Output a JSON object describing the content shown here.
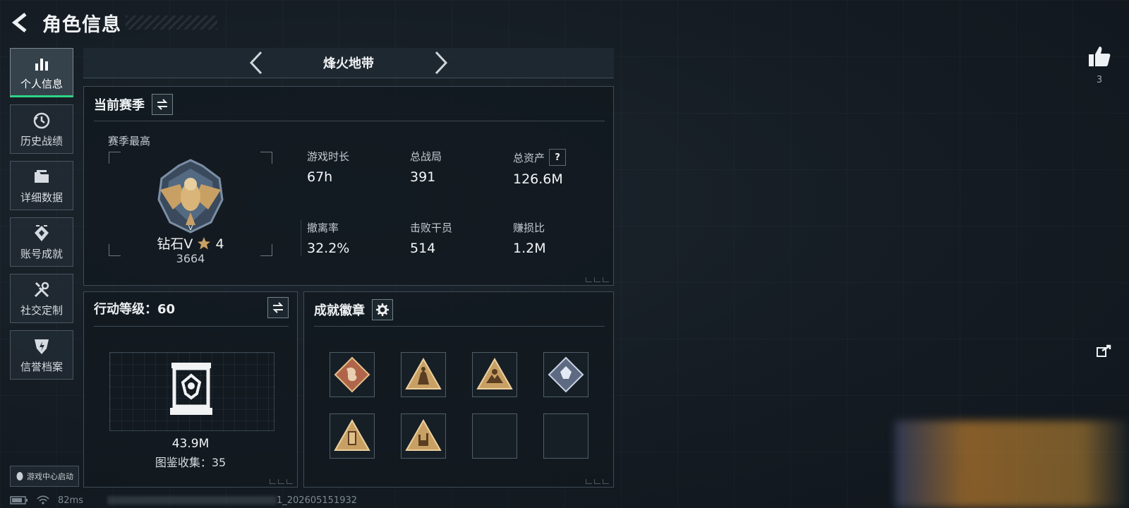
{
  "header": {
    "title": "角色信息"
  },
  "sidebar": {
    "items": [
      {
        "label": "个人信息",
        "icon": "bar-chart-icon",
        "active": true
      },
      {
        "label": "历史战绩",
        "icon": "clock-history-icon"
      },
      {
        "label": "详细数据",
        "icon": "folder-icon"
      },
      {
        "label": "账号成就",
        "icon": "achievement-icon"
      },
      {
        "label": "社交定制",
        "icon": "tools-icon"
      },
      {
        "label": "信誉档案",
        "icon": "shield-icon"
      }
    ],
    "game_center_label": "游戏中心启动"
  },
  "mode_selector": {
    "name": "烽火地带"
  },
  "season": {
    "title": "当前赛季",
    "best_label": "赛季最高",
    "rank_name": "钻石V",
    "rank_stars": "4",
    "rank_score": "3664",
    "stats": [
      {
        "label": "游戏时长",
        "value": "67h"
      },
      {
        "label": "总战局",
        "value": "391"
      },
      {
        "label": "总资产",
        "value": "126.6M",
        "help": "?"
      },
      {
        "label": "撤离率",
        "value": "32.2%"
      },
      {
        "label": "击败干员",
        "value": "514"
      },
      {
        "label": "赚损比",
        "value": "1.2M"
      }
    ]
  },
  "action_level": {
    "title": "行动等级：60",
    "value": "43.9M",
    "collection": "图鉴收集：35"
  },
  "badges": {
    "title": "成就徽章",
    "items": [
      {
        "icon": "dragon-badge-icon",
        "color": "#b0654a"
      },
      {
        "icon": "warrior-badge-icon",
        "color": "#c9a064"
      },
      {
        "icon": "hands-badge-icon",
        "color": "#c9a064"
      },
      {
        "icon": "silver-diamond-badge-icon",
        "color": "#9aa8c0"
      },
      {
        "icon": "pillar-badge-icon",
        "color": "#c9a064"
      },
      {
        "icon": "rock-hand-badge-icon",
        "color": "#c9a064"
      },
      {
        "icon": "empty-slot"
      },
      {
        "icon": "empty-slot"
      }
    ]
  },
  "likes": {
    "count": "3"
  },
  "status_bar": {
    "ping": "82ms",
    "build": "1_202605151932"
  },
  "colors": {
    "accent_green": "#2fd487",
    "gold": "#c9a064"
  }
}
